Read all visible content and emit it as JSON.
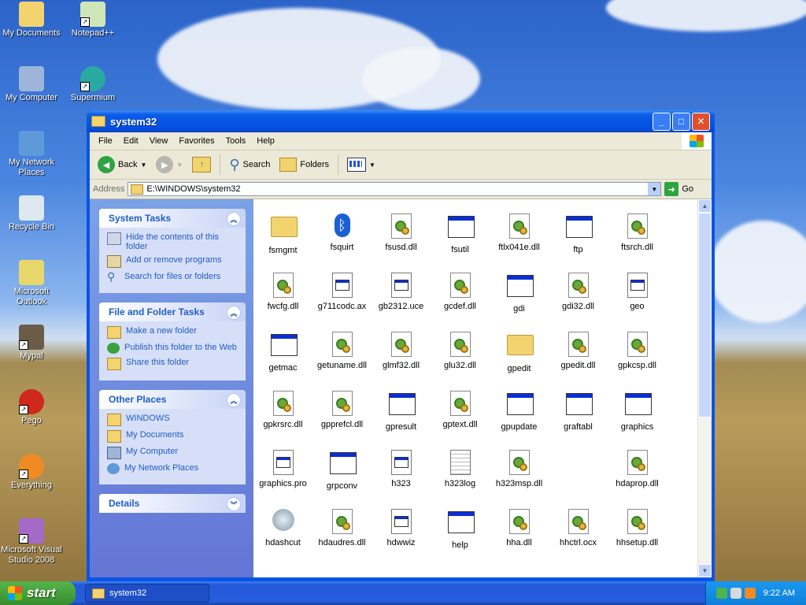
{
  "desktop": {
    "icons": [
      {
        "label": "My Documents",
        "icon": "folder-documents-icon"
      },
      {
        "label": "Notepad++",
        "icon": "notepad-plus-icon",
        "shortcut": true
      },
      {
        "label": "My Computer",
        "icon": "computer-icon"
      },
      {
        "label": "Supermium",
        "icon": "browser-icon",
        "shortcut": true
      },
      {
        "label": "My Network Places",
        "icon": "network-icon"
      },
      {
        "label": "Recycle Bin",
        "icon": "recycle-bin-icon"
      },
      {
        "label": "Microsoft Outlook",
        "icon": "outlook-icon"
      },
      {
        "label": "Mypal",
        "icon": "raccoon-icon",
        "shortcut": true
      },
      {
        "label": "Pego",
        "icon": "red-ball-icon",
        "shortcut": true
      },
      {
        "label": "Everything",
        "icon": "everything-search-icon",
        "shortcut": true
      },
      {
        "label": "Microsoft Visual Studio 2008",
        "icon": "visual-studio-icon",
        "shortcut": true
      }
    ]
  },
  "window": {
    "title": "system32",
    "menu": [
      "File",
      "Edit",
      "View",
      "Favorites",
      "Tools",
      "Help"
    ],
    "toolbar": {
      "back_label": "Back",
      "search_label": "Search",
      "folders_label": "Folders"
    },
    "address": {
      "label": "Address",
      "value": "E:\\WINDOWS\\system32",
      "go_label": "Go"
    }
  },
  "taskpane": {
    "system_tasks": {
      "title": "System Tasks",
      "items": [
        "Hide the contents of this folder",
        "Add or remove programs",
        "Search for files or folders"
      ]
    },
    "file_folder_tasks": {
      "title": "File and Folder Tasks",
      "items": [
        "Make a new folder",
        "Publish this folder to the Web",
        "Share this folder"
      ]
    },
    "other_places": {
      "title": "Other Places",
      "items": [
        "WINDOWS",
        "My Documents",
        "My Computer",
        "My Network Places"
      ]
    },
    "details": {
      "title": "Details"
    }
  },
  "files": [
    {
      "name": "fsmgmt",
      "type": "msc"
    },
    {
      "name": "fsquirt",
      "type": "bluetooth"
    },
    {
      "name": "fsusd.dll",
      "type": "dll"
    },
    {
      "name": "fsutil",
      "type": "exe"
    },
    {
      "name": "ftlx041e.dll",
      "type": "dll"
    },
    {
      "name": "ftp",
      "type": "exe"
    },
    {
      "name": "ftsrch.dll",
      "type": "dll"
    },
    {
      "name": "fwcfg.dll",
      "type": "dll"
    },
    {
      "name": "g711codc.ax",
      "type": "file"
    },
    {
      "name": "gb2312.uce",
      "type": "file"
    },
    {
      "name": "gcdef.dll",
      "type": "dll"
    },
    {
      "name": "gdi",
      "type": "exe"
    },
    {
      "name": "gdi32.dll",
      "type": "dll"
    },
    {
      "name": "geo",
      "type": "file"
    },
    {
      "name": "getmac",
      "type": "exe"
    },
    {
      "name": "getuname.dll",
      "type": "dll"
    },
    {
      "name": "glmf32.dll",
      "type": "dll"
    },
    {
      "name": "glu32.dll",
      "type": "dll"
    },
    {
      "name": "gpedit",
      "type": "msc"
    },
    {
      "name": "gpedit.dll",
      "type": "dll"
    },
    {
      "name": "gpkcsp.dll",
      "type": "dll"
    },
    {
      "name": "gpkrsrc.dll",
      "type": "dll"
    },
    {
      "name": "gpprefcl.dll",
      "type": "dll"
    },
    {
      "name": "gpresult",
      "type": "exe"
    },
    {
      "name": "gptext.dll",
      "type": "dll"
    },
    {
      "name": "gpupdate",
      "type": "exe"
    },
    {
      "name": "graftabl",
      "type": "exe"
    },
    {
      "name": "graphics",
      "type": "exe"
    },
    {
      "name": "graphics.pro",
      "type": "file"
    },
    {
      "name": "grpconv",
      "type": "exe"
    },
    {
      "name": "h323",
      "type": "file"
    },
    {
      "name": "h323log",
      "type": "text"
    },
    {
      "name": "h323msp.dll",
      "type": "dll"
    },
    {
      "name": "",
      "type": "blank"
    },
    {
      "name": "hdaprop.dll",
      "type": "dll"
    },
    {
      "name": "hdashcut",
      "type": "speaker"
    },
    {
      "name": "hdaudres.dll",
      "type": "dll"
    },
    {
      "name": "hdwwiz",
      "type": "file"
    },
    {
      "name": "help",
      "type": "exe"
    },
    {
      "name": "hha.dll",
      "type": "dll"
    },
    {
      "name": "hhctrl.ocx",
      "type": "dll"
    },
    {
      "name": "hhsetup.dll",
      "type": "dll"
    }
  ],
  "taskbar": {
    "start_label": "start",
    "task_label": "system32",
    "clock": "9:22 AM"
  },
  "colors": {
    "title_blue": "#0a54e3",
    "task_link": "#215dc6",
    "taskbar_blue": "#245edb",
    "start_green": "#388e2f"
  }
}
